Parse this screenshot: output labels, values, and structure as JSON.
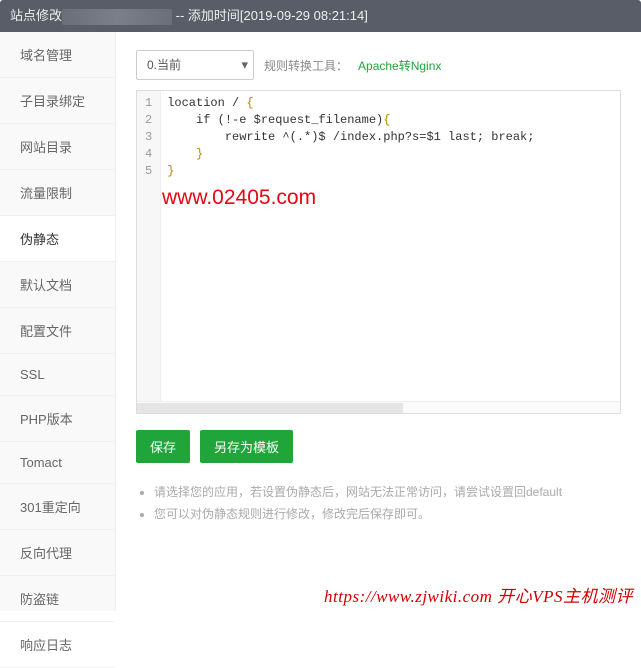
{
  "header": {
    "prefix": "站点修改",
    "suffix": " -- 添加时间[2019-09-29 08:21:14]"
  },
  "sidebar": {
    "items": [
      {
        "label": "域名管理",
        "name": "sidebar-item-domain",
        "active": false
      },
      {
        "label": "子目录绑定",
        "name": "sidebar-item-subdir",
        "active": false
      },
      {
        "label": "网站目录",
        "name": "sidebar-item-webdir",
        "active": false
      },
      {
        "label": "流量限制",
        "name": "sidebar-item-traffic",
        "active": false
      },
      {
        "label": "伪静态",
        "name": "sidebar-item-rewrite",
        "active": true
      },
      {
        "label": "默认文档",
        "name": "sidebar-item-defaultdoc",
        "active": false
      },
      {
        "label": "配置文件",
        "name": "sidebar-item-config",
        "active": false
      },
      {
        "label": "SSL",
        "name": "sidebar-item-ssl",
        "active": false
      },
      {
        "label": "PHP版本",
        "name": "sidebar-item-php",
        "active": false
      },
      {
        "label": "Tomact",
        "name": "sidebar-item-tomcat",
        "active": false
      },
      {
        "label": "301重定向",
        "name": "sidebar-item-301",
        "active": false
      },
      {
        "label": "反向代理",
        "name": "sidebar-item-proxy",
        "active": false
      },
      {
        "label": "防盗链",
        "name": "sidebar-item-hotlink",
        "active": false
      },
      {
        "label": "响应日志",
        "name": "sidebar-item-log",
        "active": false
      }
    ]
  },
  "toolbar": {
    "select_value": "0.当前",
    "convert_label": "规则转换工具：",
    "convert_link": "Apache转Nginx"
  },
  "editor": {
    "lines": [
      "location / {",
      "    if (!-e $request_filename){",
      "        rewrite ^(.*)$ /index.php?s=$1 last; break;",
      "    }",
      "}"
    ]
  },
  "buttons": {
    "save": "保存",
    "save_as_template": "另存为模板"
  },
  "tips": {
    "t1": "请选择您的应用，若设置伪静态后，网站无法正常访问，请尝试设置回default",
    "t2": "您可以对伪静态规则进行修改，修改完后保存即可。"
  },
  "watermarks": {
    "w1": "www.02405.com",
    "w2_url": "https://www.zjwiki.com ",
    "w2_cn": "开心VPS主机测评"
  }
}
